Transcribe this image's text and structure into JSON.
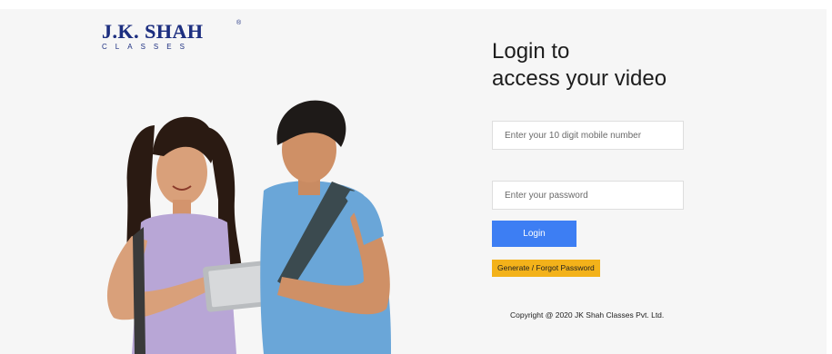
{
  "brand": {
    "name": "J.K. SHAH",
    "registered_mark": "®",
    "subtitle": "CLASSES"
  },
  "hero": {
    "image_description_icon": "students-with-tablet-illustration"
  },
  "login": {
    "heading_line1": "Login to",
    "heading_line2": "access your video",
    "mobile_placeholder": "Enter your 10 digit mobile number",
    "mobile_value": "",
    "password_placeholder": "Enter your password",
    "password_value": "",
    "login_label": "Login",
    "forgot_label": "Generate / Forgot Password"
  },
  "footer": {
    "copyright": "Copyright @ 2020 JK Shah Classes Pvt. Ltd."
  },
  "colors": {
    "brand_navy": "#1d2f80",
    "login_blue": "#3d7ef3",
    "forgot_amber": "#f3b21a",
    "page_bg": "#f6f6f6"
  }
}
